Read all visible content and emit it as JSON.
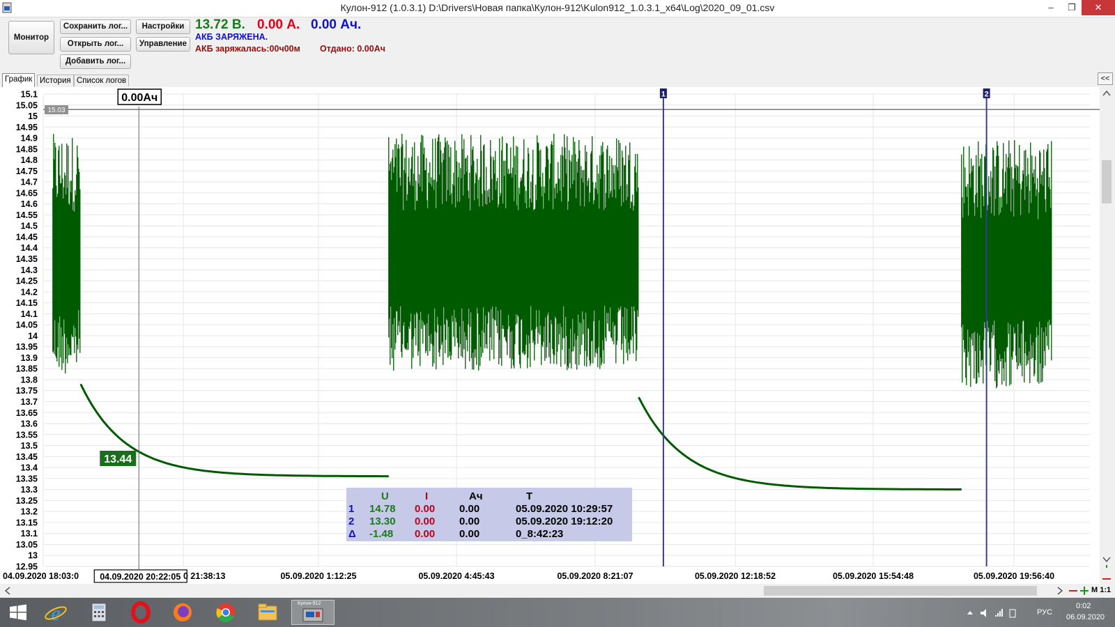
{
  "window": {
    "title": "Кулон-912 (1.0.3.1) D:\\Drivers\\Новая папка\\Кулон-912\\Kulon912_1.0.3.1_x64\\Log\\2020_09_01.csv",
    "minimize": "–",
    "restore": "❐",
    "close": "✕"
  },
  "toolbar": {
    "monitor": "Монитор",
    "save_log": "Сохранить лог...",
    "open_log": "Открыть лог...",
    "add_log": "Добавить лог...",
    "settings": "Настройки",
    "control": "Управление"
  },
  "status": {
    "voltage": "13.72 В.",
    "current": "0.00 А.",
    "capacity": "0.00 Ач.",
    "battery_state": "АКБ ЗАРЯЖЕНА.",
    "charged_time": "АКБ заряжалась:00ч00м",
    "delivered": "Отдано: 0.00Ач",
    "colors": {
      "voltage": "#1a7a1a",
      "current": "#e0001a",
      "capacity": "#1010c8",
      "state": "#1010c8",
      "info": "#9a0a0a"
    }
  },
  "tabs": [
    {
      "label": "График",
      "active": true
    },
    {
      "label": "История",
      "active": false
    },
    {
      "label": "Список логов",
      "active": false
    }
  ],
  "collapse_button": "<<",
  "chart_data": {
    "type": "line",
    "ylim": [
      12.95,
      15.1
    ],
    "y_step": 0.05,
    "y_ticks": [
      "15.1",
      "15.05",
      "15",
      "14.95",
      "14.9",
      "14.85",
      "14.8",
      "14.75",
      "14.7",
      "14.65",
      "14.6",
      "14.55",
      "14.5",
      "14.45",
      "14.4",
      "14.35",
      "14.3",
      "14.25",
      "14.2",
      "14.15",
      "14.1",
      "14.05",
      "14",
      "13.95",
      "13.9",
      "13.85",
      "13.8",
      "13.75",
      "13.7",
      "13.65",
      "13.6",
      "13.55",
      "13.5",
      "13.45",
      "13.4",
      "13.35",
      "13.3",
      "13.25",
      "13.2",
      "13.15",
      "13.1",
      "13.05",
      "13",
      "12.95"
    ],
    "x_tick_labels": [
      "04.09.2020 18:03:0",
      "04.09.2020 20:22:05",
      "0 21:38:13",
      "05.09.2020 1:12:25",
      "05.09.2020 4:45:43",
      "05.09.2020 8:21:07",
      "05.09.2020 12:18:52",
      "05.09.2020 15:54:48",
      "05.09.2020 19:56:40"
    ],
    "series": [
      {
        "color": "#005a00",
        "segments": [
          {
            "from": "04.09.2020 18:03",
            "to": "04.09.2020 18:48",
            "pattern": "noise",
            "low": 13.82,
            "high": 14.92
          },
          {
            "from": "04.09.2020 18:48",
            "to": "05.09.2020 3:06",
            "pattern": "decay",
            "start": 13.78,
            "end": 13.36
          },
          {
            "from": "05.09.2020 3:06",
            "to": "05.09.2020 9:50",
            "pattern": "noise",
            "low": 13.84,
            "high": 14.92
          },
          {
            "from": "05.09.2020 9:50",
            "to": "05.09.2020 18:32",
            "pattern": "decay",
            "start": 13.72,
            "end": 13.3
          },
          {
            "from": "05.09.2020 18:32",
            "to": "05.09.2020 20:58",
            "pattern": "noise",
            "low": 13.76,
            "high": 14.9
          }
        ]
      }
    ],
    "reference_line": {
      "value": "15.03",
      "label": "15.03"
    },
    "cursor": {
      "time": "04.09.2020 20:22:05",
      "capacity_label": "0.00Ач",
      "value_label": "13.44"
    },
    "markers": [
      {
        "label": "1",
        "time": "05.09.2020 10:29:57"
      },
      {
        "label": "2",
        "time": "05.09.2020 19:12:20"
      }
    ],
    "marker_color": "#3a3a9e",
    "grid": true
  },
  "stats_table": {
    "headers": [
      "U",
      "I",
      "Ач",
      "T"
    ],
    "rows": [
      {
        "label": "1",
        "u": "14.78",
        "i": "0.00",
        "ah": "0.00",
        "t": "05.09.2020 10:29:57"
      },
      {
        "label": "2",
        "u": "13.30",
        "i": "0.00",
        "ah": "0.00",
        "t": "05.09.2020 19:12:20"
      },
      {
        "label": "Δ",
        "u": "-1.48",
        "i": "0.00",
        "ah": "0.00",
        "t": "0_8:42:23"
      }
    ]
  },
  "zoom": {
    "scale": "M 1:1"
  },
  "taskbar": {
    "apps": [
      "start-windows-icon",
      "internet-explorer-icon",
      "calculator-icon",
      "opera-icon",
      "firefox-icon",
      "chrome-icon",
      "file-explorer-icon",
      "kulon-912-app-icon"
    ],
    "active_app_caption": "Кулон-912",
    "language": "РУС",
    "time": "0:02",
    "date": "06.09.2020"
  }
}
